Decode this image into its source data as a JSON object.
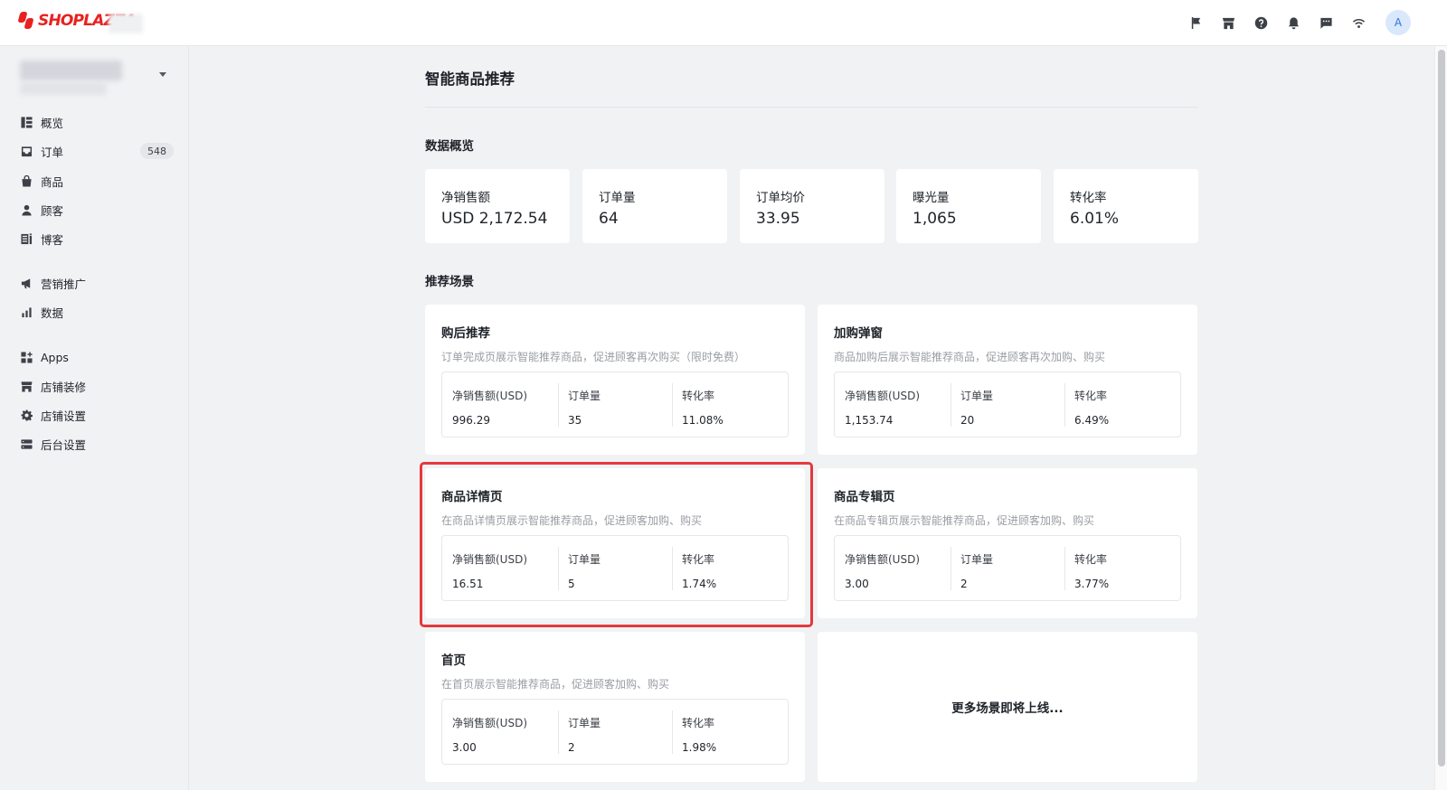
{
  "app": {
    "logo_text": "SHOPLAZZA",
    "avatar_initial": "A",
    "brand_color": "#e8211f"
  },
  "top_icons": [
    "flag-icon",
    "store-icon",
    "help-icon",
    "bell-icon",
    "chat-icon",
    "wifi-icon"
  ],
  "sidebar": {
    "items": [
      {
        "label": "概览",
        "icon": "overview-icon"
      },
      {
        "label": "订单",
        "icon": "inbox-icon",
        "badge": "548"
      },
      {
        "label": "商品",
        "icon": "bag-icon"
      },
      {
        "label": "顾客",
        "icon": "person-icon"
      },
      {
        "label": "博客",
        "icon": "blog-icon"
      },
      {
        "label": "营销推广",
        "icon": "megaphone-icon"
      },
      {
        "label": "数据",
        "icon": "bar-chart-icon"
      },
      {
        "label": "Apps",
        "icon": "apps-icon"
      },
      {
        "label": "店铺装修",
        "icon": "storefront-icon"
      },
      {
        "label": "店铺设置",
        "icon": "gear-icon"
      },
      {
        "label": "后台设置",
        "icon": "server-icon"
      }
    ]
  },
  "main": {
    "page_title": "智能商品推荐",
    "overview_title": "数据概览",
    "stats": [
      {
        "label": "净销售额",
        "value": "USD 2,172.54"
      },
      {
        "label": "订单量",
        "value": "64"
      },
      {
        "label": "订单均价",
        "value": "33.95"
      },
      {
        "label": "曝光量",
        "value": "1,065"
      },
      {
        "label": "转化率",
        "value": "6.01%"
      }
    ],
    "scenes_title": "推荐场景",
    "scenes": [
      {
        "title": "购后推荐",
        "desc": "订单完成页展示智能推荐商品，促进顾客再次购买（限时免费）",
        "metrics": [
          {
            "label": "净销售额(USD)",
            "value": "996.29"
          },
          {
            "label": "订单量",
            "value": "35"
          },
          {
            "label": "转化率",
            "value": "11.08%"
          }
        ]
      },
      {
        "title": "加购弹窗",
        "desc": "商品加购后展示智能推荐商品，促进顾客再次加购、购买",
        "metrics": [
          {
            "label": "净销售额(USD)",
            "value": "1,153.74"
          },
          {
            "label": "订单量",
            "value": "20"
          },
          {
            "label": "转化率",
            "value": "6.49%"
          }
        ]
      },
      {
        "title": "商品详情页",
        "desc": "在商品详情页展示智能推荐商品，促进顾客加购、购买",
        "metrics": [
          {
            "label": "净销售额(USD)",
            "value": "16.51"
          },
          {
            "label": "订单量",
            "value": "5"
          },
          {
            "label": "转化率",
            "value": "1.74%"
          }
        ]
      },
      {
        "title": "商品专辑页",
        "desc": "在商品专辑页展示智能推荐商品，促进顾客加购、购买",
        "metrics": [
          {
            "label": "净销售额(USD)",
            "value": "3.00"
          },
          {
            "label": "订单量",
            "value": "2"
          },
          {
            "label": "转化率",
            "value": "3.77%"
          }
        ]
      },
      {
        "title": "首页",
        "desc": "在首页展示智能推荐商品，促进顾客加购、购买",
        "metrics": [
          {
            "label": "净销售额(USD)",
            "value": "3.00"
          },
          {
            "label": "订单量",
            "value": "2"
          },
          {
            "label": "转化率",
            "value": "1.98%"
          }
        ]
      }
    ],
    "more_scenes_text": "更多场景即将上线...",
    "highlight_color": "#e4393c"
  }
}
